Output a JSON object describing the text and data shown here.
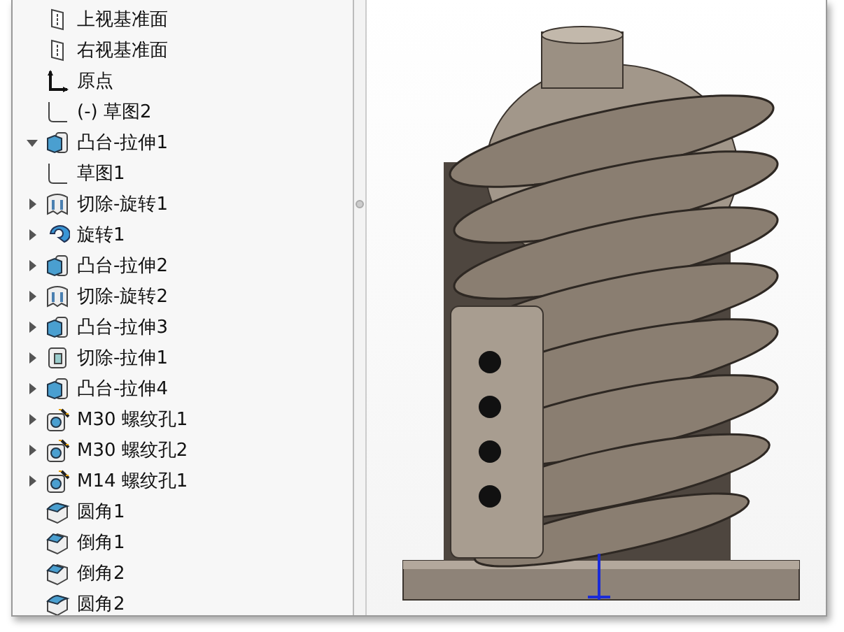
{
  "feature_tree": [
    {
      "label": "上视基准面",
      "kind": "plane"
    },
    {
      "label": "右视基准面",
      "kind": "plane"
    },
    {
      "label": "原点",
      "kind": "origin"
    },
    {
      "label": "(-) 草图2",
      "kind": "sketch"
    },
    {
      "label": "凸台-拉伸1",
      "kind": "extrude",
      "expanded": true,
      "children": [
        {
          "label": "草图1",
          "kind": "sketch"
        }
      ]
    },
    {
      "label": "切除-旋转1",
      "kind": "cut-revolve",
      "expanded": false
    },
    {
      "label": "旋转1",
      "kind": "revolve",
      "expanded": false
    },
    {
      "label": "凸台-拉伸2",
      "kind": "extrude",
      "expanded": false
    },
    {
      "label": "切除-旋转2",
      "kind": "cut-revolve",
      "expanded": false
    },
    {
      "label": "凸台-拉伸3",
      "kind": "extrude",
      "expanded": false
    },
    {
      "label": "切除-拉伸1",
      "kind": "cut-extrude",
      "expanded": false
    },
    {
      "label": "凸台-拉伸4",
      "kind": "extrude",
      "expanded": false
    },
    {
      "label": "M30 螺纹孔1",
      "kind": "hole",
      "expanded": false
    },
    {
      "label": "M30 螺纹孔2",
      "kind": "hole",
      "expanded": false
    },
    {
      "label": "M14 螺纹孔1",
      "kind": "hole",
      "expanded": false
    },
    {
      "label": "圆角1",
      "kind": "fillet"
    },
    {
      "label": "倒角1",
      "kind": "chamfer"
    },
    {
      "label": "倒角2",
      "kind": "chamfer"
    },
    {
      "label": "圆角2",
      "kind": "fillet"
    }
  ]
}
